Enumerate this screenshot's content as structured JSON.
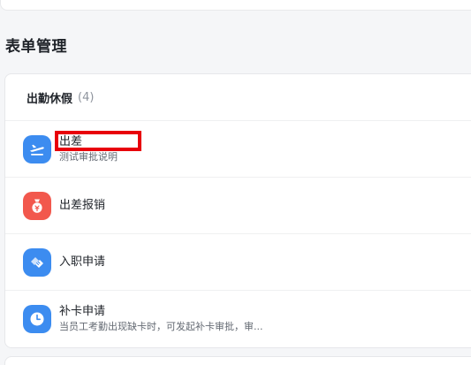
{
  "page": {
    "title": "表单管理"
  },
  "group": {
    "title": "出勤休假",
    "count": "(4)",
    "items": [
      {
        "title": "出差",
        "desc": "测试审批说明",
        "icon": "airplane-icon",
        "color": "#3c8cf0"
      },
      {
        "title": "出差报销",
        "desc": "",
        "icon": "money-bag-icon",
        "color": "#f2584d"
      },
      {
        "title": "入职申请",
        "desc": "",
        "icon": "handshake-icon",
        "color": "#3c8cf0"
      },
      {
        "title": "补卡申请",
        "desc": "当员工考勤出现缺卡时，可发起补卡审批，审...",
        "icon": "clock-icon",
        "color": "#3c8cf0"
      }
    ]
  }
}
